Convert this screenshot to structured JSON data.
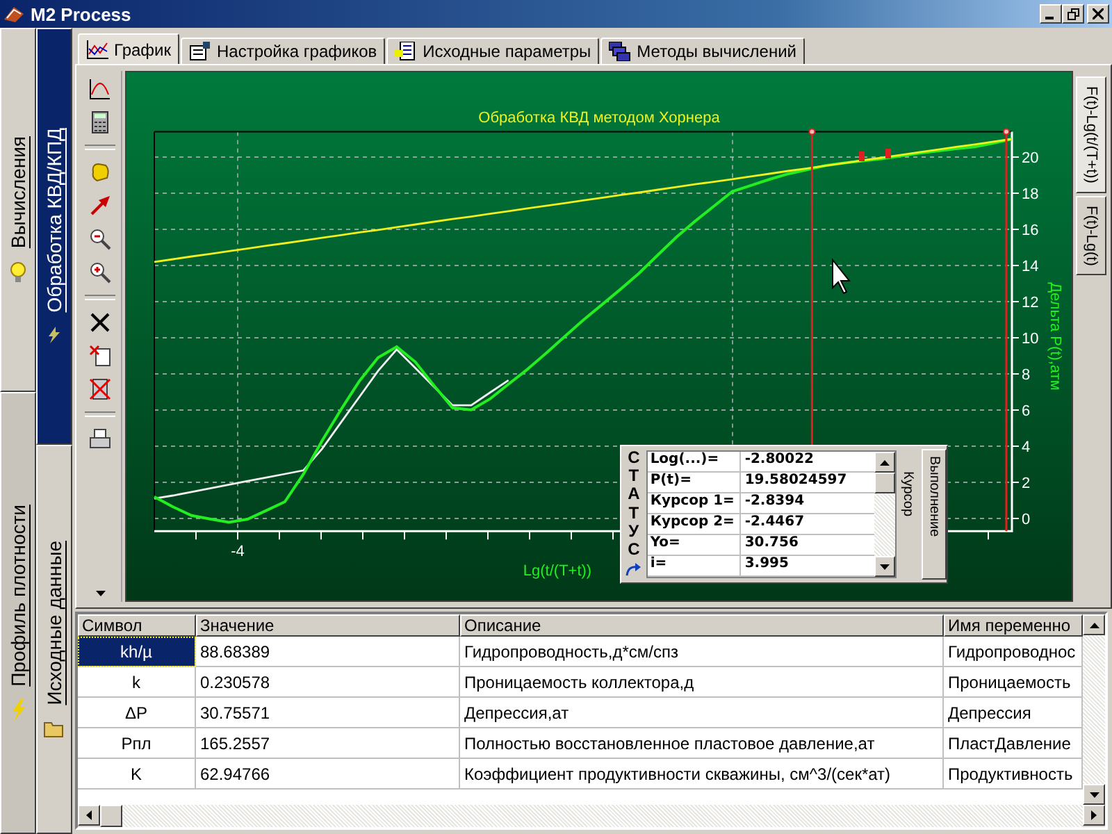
{
  "window": {
    "title": "M2 Process"
  },
  "side_tabs": [
    {
      "label": "Вычисления",
      "selected": true
    },
    {
      "label": "Профиль плотности",
      "selected": false
    }
  ],
  "section_tabs": [
    {
      "label": "Обработка КВД/КПД",
      "selected": true
    },
    {
      "label": "Исходные данные",
      "selected": false
    }
  ],
  "tabs": [
    {
      "label": "График",
      "selected": true
    },
    {
      "label": "Настройка графиков",
      "selected": false
    },
    {
      "label": "Исходные параметры",
      "selected": false
    },
    {
      "label": "Методы вычислений",
      "selected": false
    }
  ],
  "chart": {
    "x_tick_label": "-4",
    "chart_data": {
      "type": "line",
      "title": "Обработка КВД методом Хорнера",
      "xlabel": "Lg(t/(T+t))",
      "ylabel": "Дельта P(t),атм",
      "grid": true,
      "series": [
        {
          "color": "#f0f0f0",
          "values": [
            1.1,
            1.27,
            1.47,
            1.67,
            1.87,
            2.07,
            2.26,
            2.46,
            2.66,
            3.85,
            5.29,
            6.72,
            8.17,
            9.35,
            8.32,
            7.29,
            6.26,
            6.26,
            6.96,
            7.65,
            null,
            null,
            null,
            null,
            null,
            null,
            null,
            null,
            null,
            null,
            null,
            null,
            null,
            null,
            null,
            null,
            null,
            null,
            null,
            null,
            null,
            null,
            null,
            null,
            null,
            null,
            null
          ]
        },
        {
          "color": "#22ee22",
          "values": [
            1.2,
            0.65,
            0.16,
            -0.03,
            -0.21,
            -0.04,
            0.44,
            0.92,
            2.45,
            4.3,
            6.0,
            7.6,
            8.9,
            9.5,
            8.66,
            7.35,
            6.12,
            6.01,
            6.61,
            7.43,
            8.25,
            9.13,
            10.05,
            10.97,
            11.82,
            12.68,
            13.57,
            14.58,
            15.57,
            16.45,
            17.27,
            18.09,
            18.43,
            18.77,
            19.07,
            19.3,
            19.53,
            19.68,
            19.79,
            19.9,
            20.06,
            20.21,
            20.34,
            20.46,
            20.57,
            20.77,
            21.0
          ]
        },
        {
          "color": "#f0f020",
          "values": [
            14.2,
            14.35,
            14.5,
            14.64,
            14.79,
            14.94,
            15.09,
            15.23,
            15.38,
            15.53,
            15.68,
            15.83,
            15.97,
            16.12,
            16.27,
            16.42,
            16.57,
            16.71,
            16.86,
            17.01,
            17.16,
            17.3,
            17.45,
            17.6,
            17.75,
            17.9,
            18.04,
            18.19,
            18.34,
            18.49,
            18.63,
            18.78,
            18.93,
            19.08,
            19.23,
            19.37,
            19.52,
            19.67,
            19.82,
            19.96,
            20.11,
            20.26,
            20.41,
            20.56,
            20.7,
            20.85,
            21.0
          ]
        }
      ],
      "ylim": [
        -0.7,
        21.4
      ],
      "yticks": [
        {
          "value": 20,
          "label": "20"
        },
        {
          "value": 18,
          "label": "18"
        },
        {
          "value": 16,
          "label": "16"
        },
        {
          "value": 14,
          "label": "14"
        },
        {
          "value": 12,
          "label": "12"
        },
        {
          "value": 10,
          "label": "10"
        },
        {
          "value": 8,
          "label": "8"
        },
        {
          "value": 6,
          "label": "6"
        },
        {
          "value": 4,
          "label": "4"
        },
        {
          "value": 2,
          "label": "2"
        },
        {
          "value": 0,
          "label": "0"
        }
      ]
    }
  },
  "view_tabs": [
    {
      "label": "F(t)-Lg(t/(T+t))",
      "selected": true
    },
    {
      "label": "F(t)-Lg(t)",
      "selected": false
    }
  ],
  "status_panel": {
    "label": "СТАТУС",
    "rows": [
      {
        "label": "Log(...)=",
        "value": "-2.80022"
      },
      {
        "label": "P(t)=",
        "value": "19.58024597"
      },
      {
        "label": "Курсор 1=",
        "value": "-2.8394"
      },
      {
        "label": "Курсор 2=",
        "value": "-2.4467"
      },
      {
        "label": "Yo=",
        "value": "30.756"
      },
      {
        "label": "i=",
        "value": "3.995"
      }
    ],
    "tabs": [
      {
        "label": "Курсор",
        "selected": true
      },
      {
        "label": "Выполнение",
        "selected": false
      }
    ]
  },
  "table": {
    "columns": [
      "Символ",
      "Значение",
      "Описание",
      "Имя переменно"
    ],
    "rows": [
      {
        "cells": [
          "kh/µ",
          "88.68389",
          "Гидропроводность,д*см/спз",
          "Гидропроводнос"
        ],
        "selected": true
      },
      {
        "cells": [
          "k",
          "0.230578",
          "Проницаемость коллектора,д",
          "Проницаемость"
        ],
        "selected": false
      },
      {
        "cells": [
          "ΔP",
          "30.75571",
          "Депрессия,ат",
          "Депрессия"
        ],
        "selected": false
      },
      {
        "cells": [
          "Рпл",
          "165.2557",
          "Полностью восстановленное пластовое давление,ат",
          "ПластДавление"
        ],
        "selected": false
      },
      {
        "cells": [
          "K",
          "62.94766",
          "Коэффициент продуктивности скважины, см^3/(сек*ат)",
          "Продуктивность"
        ],
        "selected": false
      }
    ]
  }
}
